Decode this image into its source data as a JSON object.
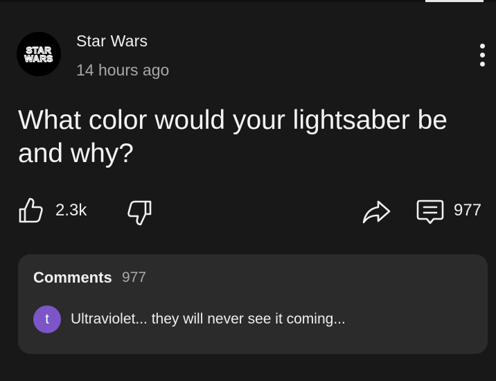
{
  "post": {
    "channel_name": "Star Wars",
    "time_ago": "14 hours ago",
    "logo_text_top": "STAR",
    "logo_text_bottom": "WARS",
    "text": "What color would your lightsaber be and why?",
    "like_count": "2.3k",
    "comment_count": "977"
  },
  "comments": {
    "title": "Comments",
    "count": "977",
    "top_comment": {
      "avatar_letter": "t",
      "avatar_color": "#7c56c8",
      "text": "Ultraviolet... they will never see it coming..."
    }
  },
  "icons": {
    "menu": "more-vert-icon",
    "like": "thumb-up-icon",
    "dislike": "thumb-down-icon",
    "share": "share-arrow-icon",
    "comments": "comment-bubble-icon"
  },
  "colors": {
    "background": "#181818",
    "panel": "#2b2b2b",
    "secondary_text": "#a8a8a8"
  }
}
